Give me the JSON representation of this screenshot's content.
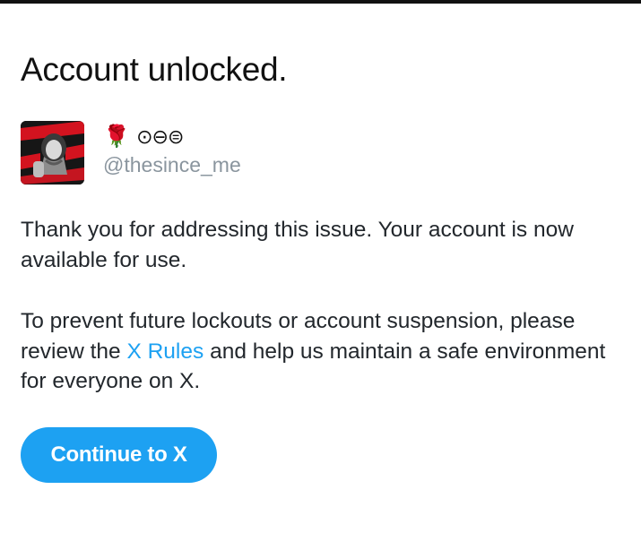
{
  "page": {
    "title": "Account unlocked."
  },
  "profile": {
    "display_name_emoji": "🌹",
    "display_name_symbols": "⊙⊖⊜",
    "handle": "@thesince_me",
    "avatar_icon": "profile-photo"
  },
  "message": {
    "paragraph1": "Thank you for addressing this issue. Your account is now available for use.",
    "paragraph2_before_link": "To prevent future lockouts or account suspension, please review the ",
    "rules_link_label": "X Rules",
    "paragraph2_after_link": " and help us maintain a safe environment for everyone on X."
  },
  "actions": {
    "continue_label": "Continue to X"
  },
  "colors": {
    "accent": "#1da1f2",
    "text": "#22272c",
    "muted": "#8a959e"
  }
}
